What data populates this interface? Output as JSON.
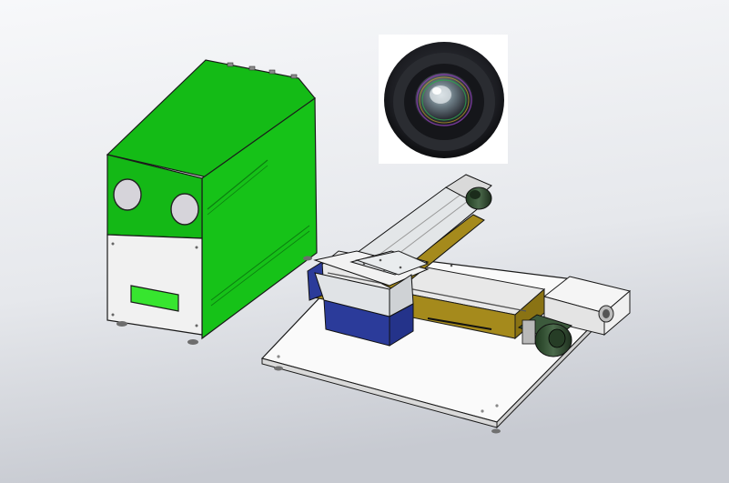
{
  "scene": {
    "background_top": "#f3f4f6",
    "background_bottom": "#c9ccd3"
  },
  "green_enclosure": {
    "body_color": "#18c518",
    "shade_color": "#0f9e12",
    "top_color": "#12b815",
    "lower_panel_color": "#f1f1f1",
    "window_color": "#37e52f",
    "porthole_color": "#d6d4da",
    "porthole_count": 2
  },
  "lens_image": {
    "icon": "camera-lens-icon",
    "frame_color": "#ffffff",
    "barrel_color": "#1a1b1f"
  },
  "xy_stage": {
    "baseplate_color": "#fafafa",
    "rail_color": "#a58a1c",
    "carriage_color": "#dde2e4",
    "end_cap_color": "#2b3b9a",
    "motor_color": "#2e4f2e",
    "sensor_housing_color": "#ececec"
  }
}
